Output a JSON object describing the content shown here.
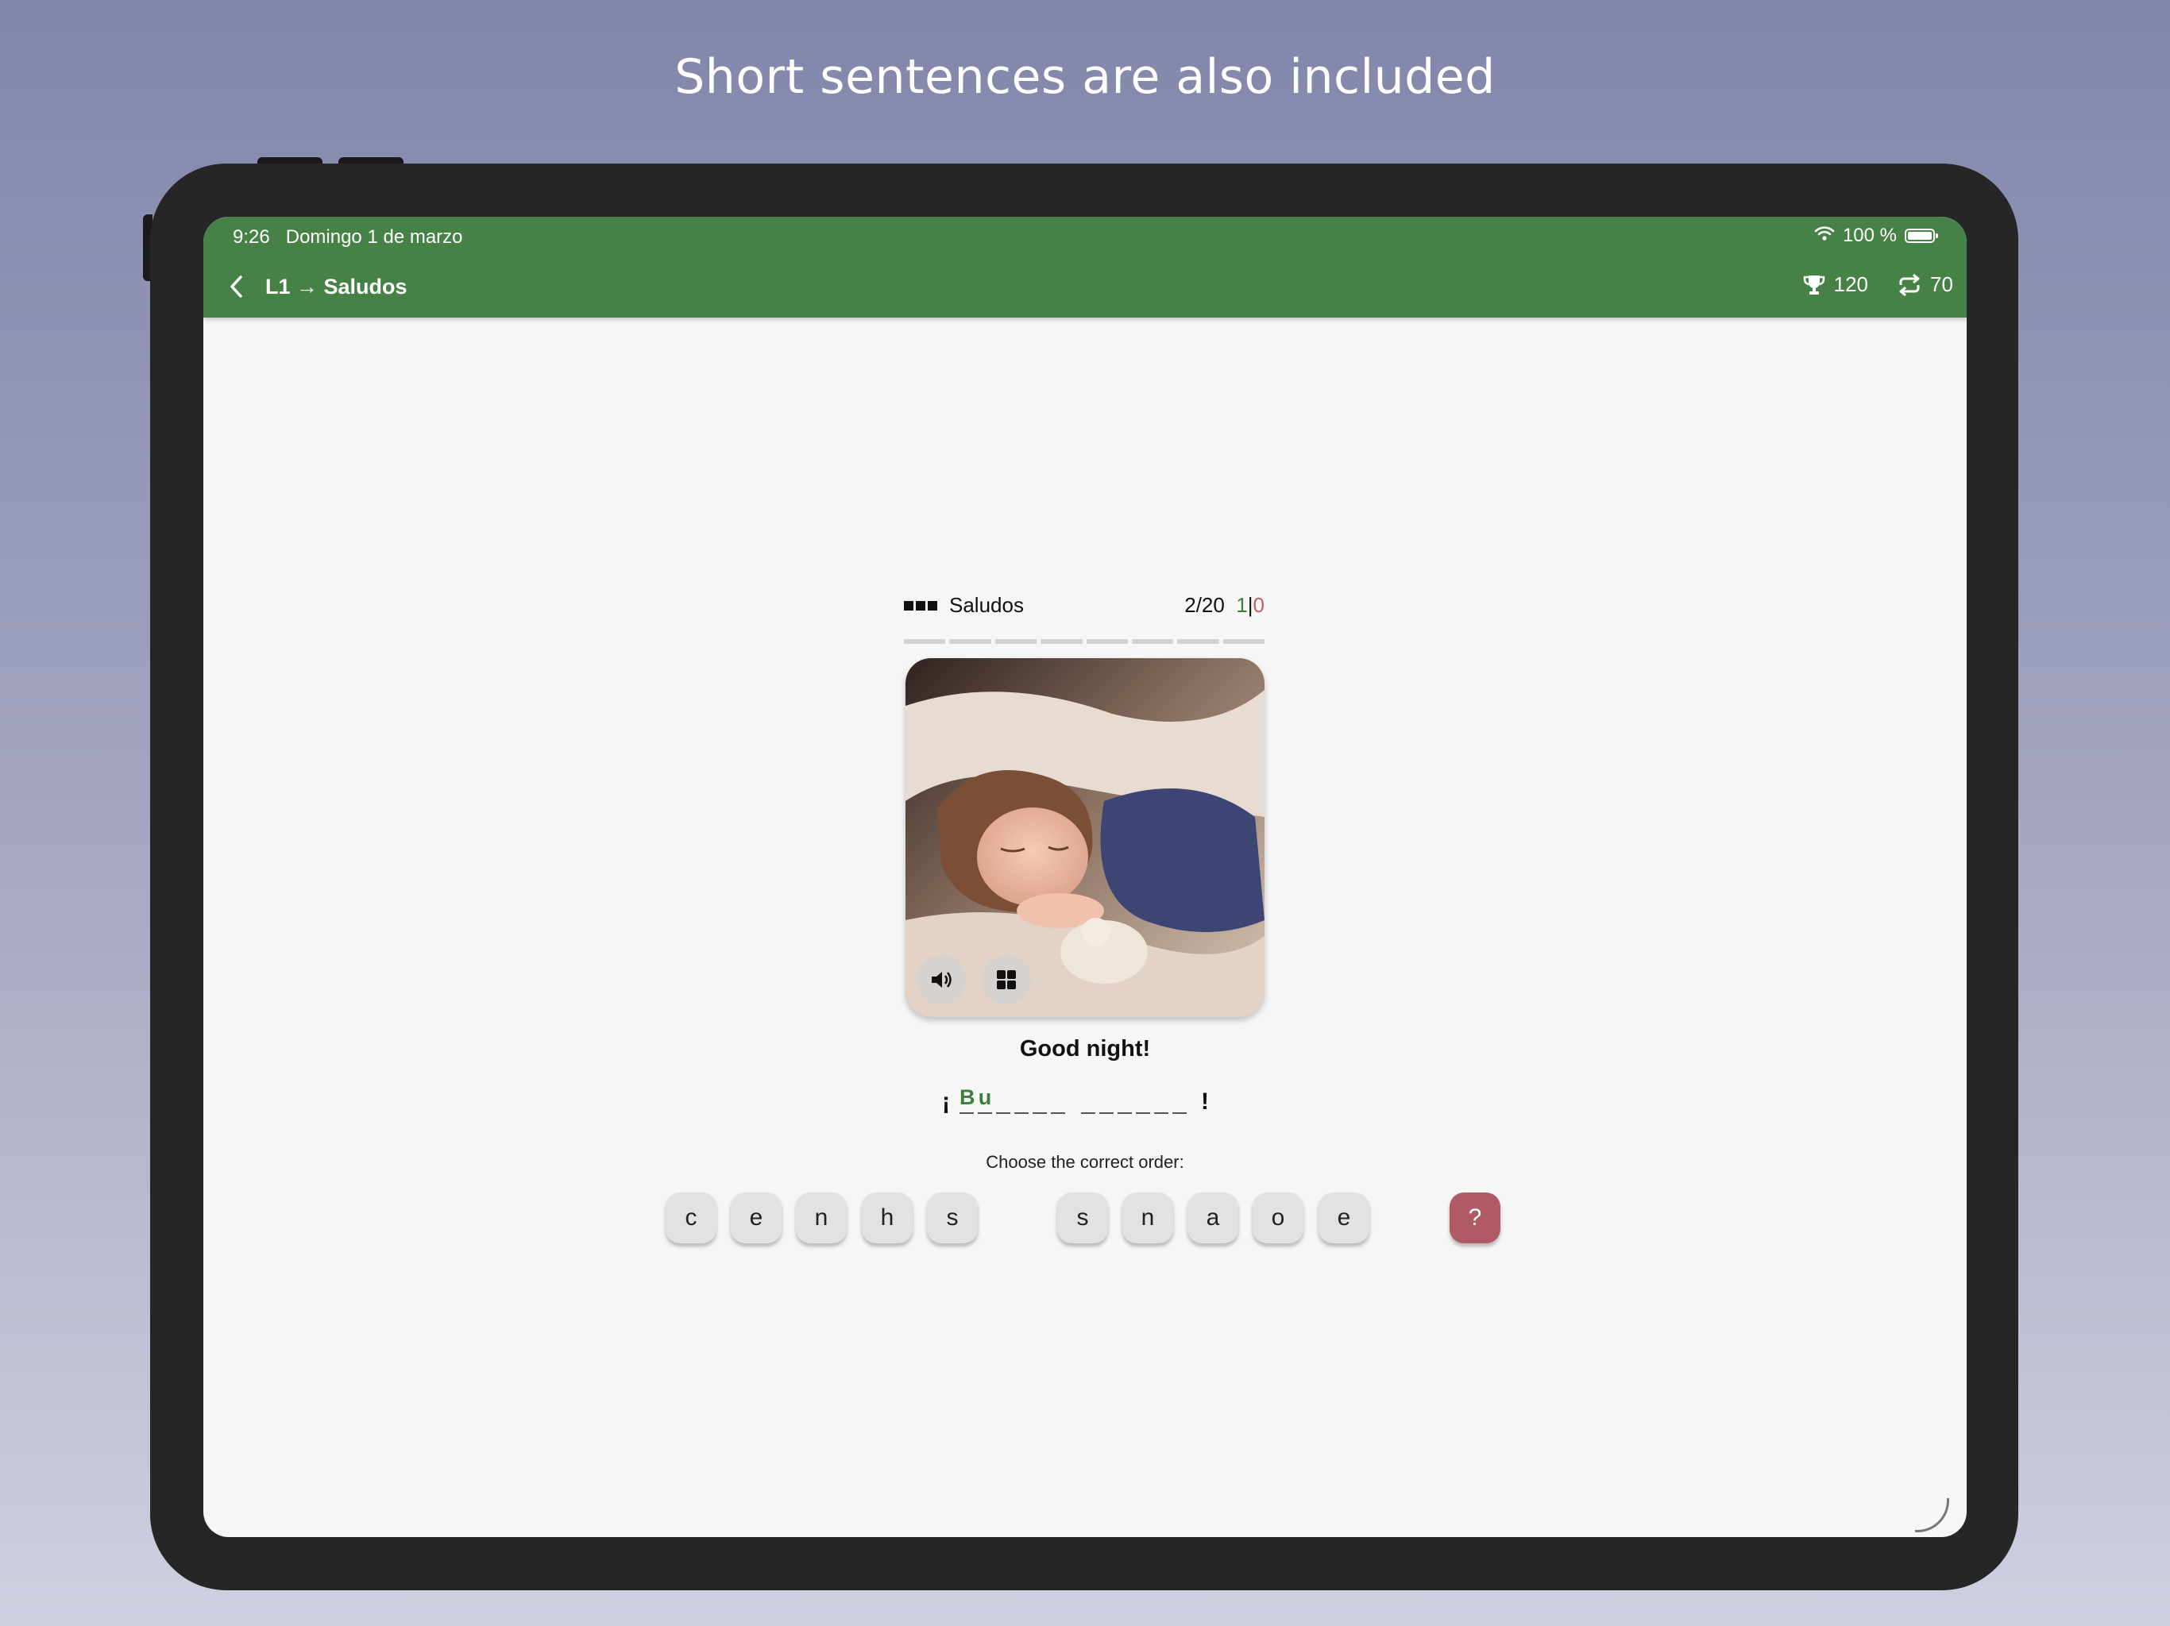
{
  "headline": "Short sentences are also included",
  "status_bar": {
    "time": "9:26",
    "date": "Domingo 1 de marzo",
    "battery": "100 %"
  },
  "nav": {
    "title": "L1 → Saludos",
    "trophy_count": "120",
    "repeat_count": "70"
  },
  "quiz": {
    "topic": "Saludos",
    "progress": "2/20",
    "correct": "1",
    "separator": "|",
    "wrong": "0",
    "phrase": "Good night!",
    "answer": {
      "open_punct": "¡",
      "close_punct": "!",
      "word1": [
        "B",
        "u",
        "",
        "",
        "",
        ""
      ],
      "word2": [
        "",
        "",
        "",
        "",
        "",
        ""
      ]
    },
    "instruction": "Choose the correct order:",
    "tiles_group1": [
      "c",
      "e",
      "n",
      "h",
      "s"
    ],
    "tiles_group2": [
      "s",
      "n",
      "a",
      "o",
      "e"
    ],
    "hint_label": "?"
  },
  "colors": {
    "app_bar": "#468246",
    "correct": "#3c7d3c",
    "wrong": "#c06068",
    "hint": "#b05a66"
  },
  "icons": [
    "back-chevron-icon",
    "trophy-icon",
    "repeat-icon",
    "wifi-icon",
    "battery-icon",
    "speaker-icon",
    "grid-icon"
  ]
}
